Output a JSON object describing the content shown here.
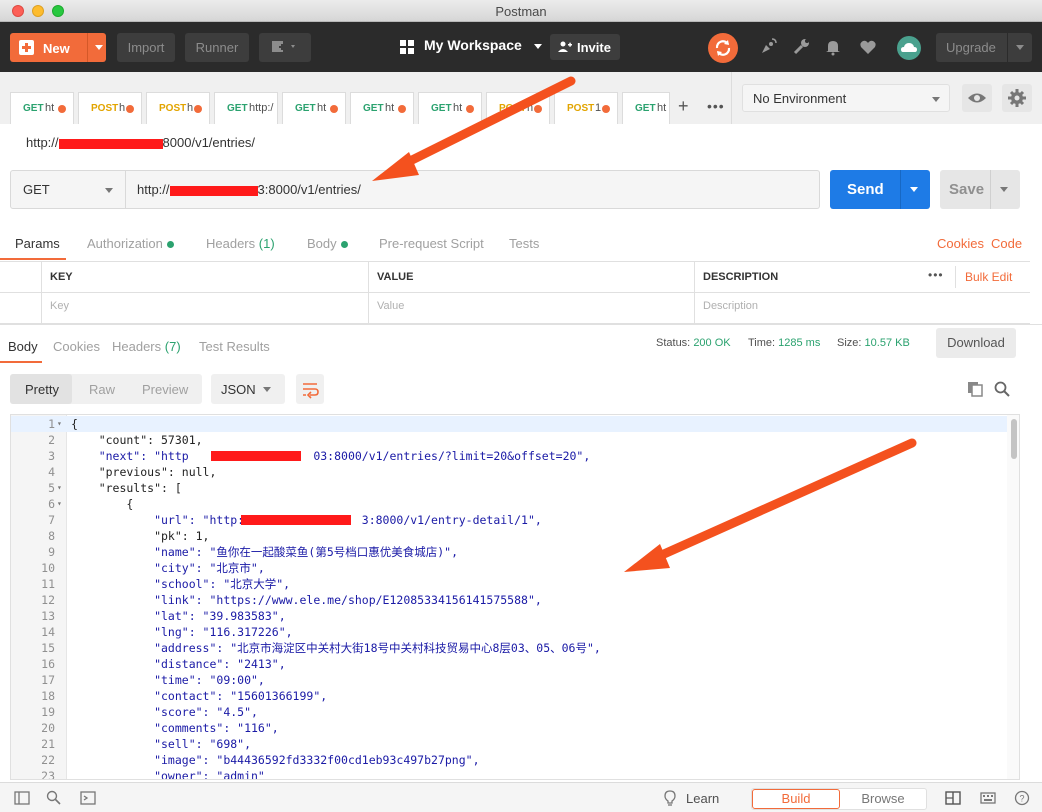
{
  "window": {
    "title": "Postman"
  },
  "toolbar": {
    "new_label": "New",
    "import_label": "Import",
    "runner_label": "Runner",
    "workspace_label": "My Workspace",
    "invite_label": "Invite",
    "upgrade_label": "Upgrade"
  },
  "tabs": [
    {
      "method": "GET",
      "name": "ht"
    },
    {
      "method": "POST",
      "name": "h"
    },
    {
      "method": "POST",
      "name": "h"
    },
    {
      "method": "GET",
      "name": "http:/"
    },
    {
      "method": "GET",
      "name": "ht"
    },
    {
      "method": "GET",
      "name": "ht"
    },
    {
      "method": "GET",
      "name": "ht"
    },
    {
      "method": "POST",
      "name": "h"
    },
    {
      "method": "POST",
      "name": "1"
    },
    {
      "method": "GET",
      "name": "ht"
    }
  ],
  "environment": {
    "selected": "No Environment"
  },
  "request": {
    "crumb_prefix": "http://",
    "crumb_suffix": "8000/v1/entries/",
    "method": "GET",
    "url_prefix": "http://",
    "url_suffix": "3:8000/v1/entries/",
    "send_label": "Send",
    "save_label": "Save"
  },
  "request_tabs": {
    "params": "Params",
    "authorization": "Authorization",
    "headers": "Headers",
    "headers_count": "(1)",
    "body": "Body",
    "prerequest": "Pre-request Script",
    "tests": "Tests",
    "cookies": "Cookies",
    "code": "Code"
  },
  "params_table": {
    "col_key": "KEY",
    "col_value": "VALUE",
    "col_description": "DESCRIPTION",
    "bulk_edit": "Bulk Edit",
    "ph_key": "Key",
    "ph_value": "Value",
    "ph_description": "Description"
  },
  "response_tabs": {
    "body": "Body",
    "cookies": "Cookies",
    "headers": "Headers",
    "headers_count": "(7)",
    "test_results": "Test Results"
  },
  "response_status": {
    "status_label": "Status:",
    "status_value": "200 OK",
    "time_label": "Time:",
    "time_value": "1285 ms",
    "size_label": "Size:",
    "size_value": "10.57 KB",
    "download_label": "Download"
  },
  "format": {
    "pretty": "Pretty",
    "raw": "Raw",
    "preview": "Preview",
    "language": "JSON"
  },
  "code_lines": [
    {
      "n": "1",
      "t": "{"
    },
    {
      "n": "2",
      "t": "    \"count\": 57301,"
    },
    {
      "n": "3",
      "t": "    \"next\": \"http                  03:8000/v1/entries/?limit=20&offset=20\","
    },
    {
      "n": "4",
      "t": "    \"previous\": null,"
    },
    {
      "n": "5",
      "t": "    \"results\": ["
    },
    {
      "n": "6",
      "t": "        {"
    },
    {
      "n": "7",
      "t": "            \"url\": \"http://               3:8000/v1/entry-detail/1\","
    },
    {
      "n": "8",
      "t": "            \"pk\": 1,"
    },
    {
      "n": "9",
      "t": "            \"name\": \"鱼你在一起酸菜鱼(第5号档口惠优美食城店)\","
    },
    {
      "n": "10",
      "t": "            \"city\": \"北京市\","
    },
    {
      "n": "11",
      "t": "            \"school\": \"北京大学\","
    },
    {
      "n": "12",
      "t": "            \"link\": \"https://www.ele.me/shop/E12085334156141575588\","
    },
    {
      "n": "13",
      "t": "            \"lat\": \"39.983583\","
    },
    {
      "n": "14",
      "t": "            \"lng\": \"116.317226\","
    },
    {
      "n": "15",
      "t": "            \"address\": \"北京市海淀区中关村大街18号中关村科技贸易中心8层03、05、06号\","
    },
    {
      "n": "16",
      "t": "            \"distance\": \"2413\","
    },
    {
      "n": "17",
      "t": "            \"time\": \"09:00\","
    },
    {
      "n": "18",
      "t": "            \"contact\": \"15601366199\","
    },
    {
      "n": "19",
      "t": "            \"score\": \"4.5\","
    },
    {
      "n": "20",
      "t": "            \"comments\": \"116\","
    },
    {
      "n": "21",
      "t": "            \"sell\": \"698\","
    },
    {
      "n": "22",
      "t": "            \"image\": \"b44436592fd3332f00cd1eb93c497b27png\","
    },
    {
      "n": "23",
      "t": "            \"owner\": \"admin\""
    }
  ],
  "bottom": {
    "learn": "Learn",
    "build": "Build",
    "browse": "Browse"
  },
  "colors": {
    "accent": "#f26b3a",
    "send": "#1e7be6",
    "get": "#2ba26f",
    "post": "#e2a400",
    "annotation": "#f4511e"
  }
}
